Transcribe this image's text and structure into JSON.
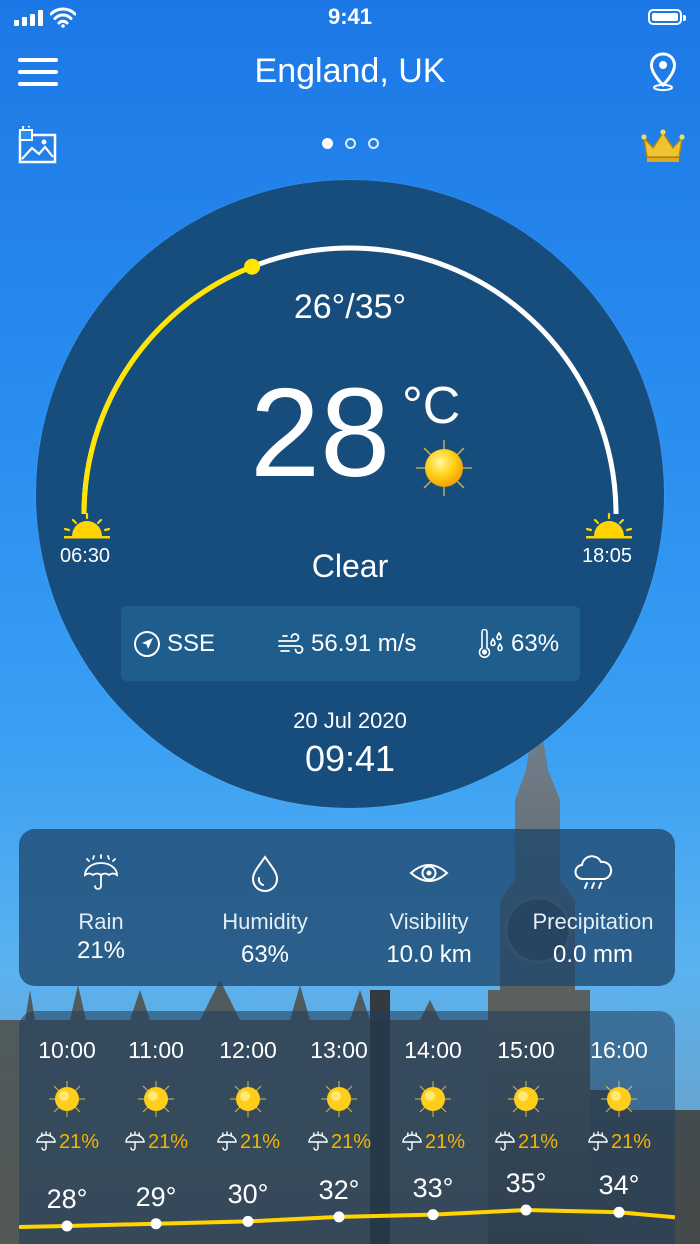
{
  "status": {
    "time": "9:41"
  },
  "header": {
    "title": "England, UK",
    "active_page": 1,
    "pages": 3
  },
  "current": {
    "min_max": "26°/35°",
    "temp": "28",
    "unit": "°C",
    "condition": "Clear",
    "sunrise": "06:30",
    "sunset": "18:05",
    "day_progress": 0.38,
    "wind_dir": "SSE",
    "wind_speed": "56.91 m/s",
    "humidity_short": "63%",
    "date": "20 Jul 2020",
    "clock": "09:41"
  },
  "details": [
    {
      "label": "Rain",
      "value": "21%",
      "icon": "umbrella-rain-icon"
    },
    {
      "label": "Humidity",
      "value": "63%",
      "icon": "droplet-icon"
    },
    {
      "label": "Visibility",
      "value": "10.0 km",
      "icon": "eye-icon"
    },
    {
      "label": "Precipitation",
      "value": "0.0 mm",
      "icon": "cloud-rain-icon"
    }
  ],
  "hourly": [
    {
      "time": "10:00",
      "pop": "21%",
      "temp": "28°",
      "t": 28
    },
    {
      "time": "11:00",
      "pop": "21%",
      "temp": "29°",
      "t": 29
    },
    {
      "time": "12:00",
      "pop": "21%",
      "temp": "30°",
      "t": 30
    },
    {
      "time": "13:00",
      "pop": "21%",
      "temp": "32°",
      "t": 32
    },
    {
      "time": "14:00",
      "pop": "21%",
      "temp": "33°",
      "t": 33
    },
    {
      "time": "15:00",
      "pop": "21%",
      "temp": "35°",
      "t": 35
    },
    {
      "time": "16:00",
      "pop": "21%",
      "temp": "34°",
      "t": 34
    }
  ],
  "colors": {
    "accent": "#ffe600",
    "precip": "#f5b400",
    "circle": "#164d7d"
  }
}
